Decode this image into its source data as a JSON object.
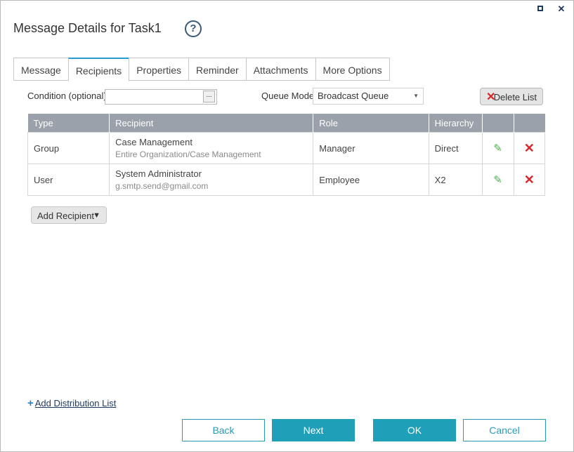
{
  "window": {
    "title": "Message Details for Task1",
    "help_glyph": "?",
    "maximize_icon": "maximize-icon",
    "close_glyph": "✕"
  },
  "tabs": [
    {
      "label": "Message"
    },
    {
      "label": "Recipients"
    },
    {
      "label": "Properties"
    },
    {
      "label": "Reminder"
    },
    {
      "label": "Attachments"
    },
    {
      "label": "More Options"
    }
  ],
  "active_tab": "Recipients",
  "condition": {
    "label": "Condition (optional)",
    "value": "",
    "browse_label": "..."
  },
  "queue_mode": {
    "label": "Queue Mode",
    "selected": "Broadcast Queue"
  },
  "delete_list": {
    "label": "Delete List"
  },
  "grid": {
    "headers": [
      "Type",
      "Recipient",
      "Role",
      "Hierarchy",
      "",
      ""
    ],
    "rows": [
      {
        "type": "Group",
        "recipient": "Case Management",
        "recipient_sub": "Entire Organization/Case Management",
        "role": "Manager",
        "hierarchy": "Direct"
      },
      {
        "type": "User",
        "recipient": "System Administrator",
        "recipient_sub": "g.smtp.send@gmail.com",
        "role": "Employee",
        "hierarchy": "X2"
      }
    ]
  },
  "add_recipient": {
    "label": "Add Recipient",
    "arrow": "▼"
  },
  "add_distribution": {
    "label": "Add Distribution List"
  },
  "footer": {
    "back": "Back",
    "next": "Next",
    "ok": "OK",
    "cancel": "Cancel"
  },
  "colors": {
    "accent": "#1fa0b8",
    "header_bg": "#9aa1aa",
    "delete_red": "#d9262b",
    "edit_green": "#4caf50"
  }
}
